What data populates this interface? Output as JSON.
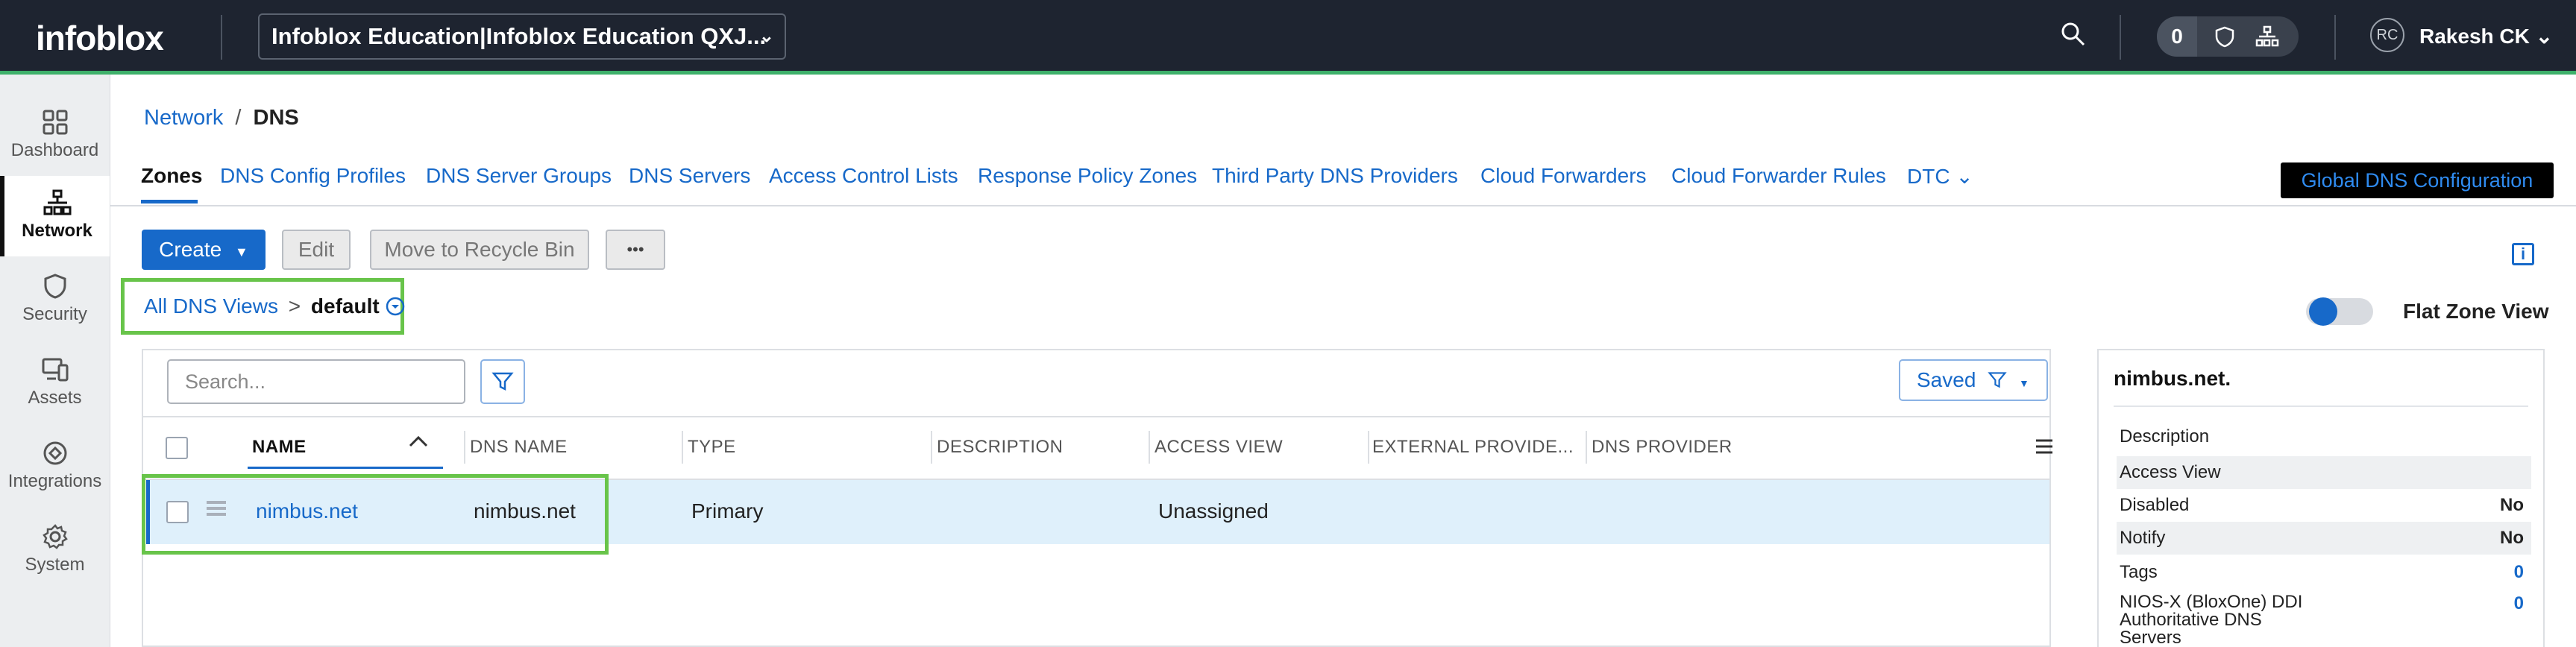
{
  "topbar": {
    "logo": "infoblox",
    "org_selector": "Infoblox Education|Infoblox Education QXJ...",
    "notification_count": "0",
    "user_initials": "RC",
    "user_name": "Rakesh CK"
  },
  "sidebar": {
    "items": [
      {
        "label": "Dashboard",
        "icon": "grid-icon"
      },
      {
        "label": "Network",
        "icon": "network-icon"
      },
      {
        "label": "Security",
        "icon": "shield-icon"
      },
      {
        "label": "Assets",
        "icon": "devices-icon"
      },
      {
        "label": "Integrations",
        "icon": "integrations-icon"
      },
      {
        "label": "System",
        "icon": "gear-icon"
      }
    ]
  },
  "breadcrumb": {
    "parent": "Network",
    "separator": "/",
    "current": "DNS"
  },
  "tabs": [
    "Zones",
    "DNS Config Profiles",
    "DNS Server Groups",
    "DNS Servers",
    "Access Control Lists",
    "Response Policy Zones",
    "Third Party DNS Providers",
    "Cloud Forwarders",
    "Cloud Forwarder Rules",
    "DTC"
  ],
  "global_button": "Global DNS Configuration",
  "toolbar": {
    "create": "Create",
    "edit": "Edit",
    "recycle": "Move to Recycle Bin",
    "more": "•••"
  },
  "views": {
    "all": "All DNS Views",
    "sep": ">",
    "current": "default"
  },
  "flat_zone_view": "Flat Zone View",
  "search": {
    "placeholder": "Search..."
  },
  "saved_button": "Saved",
  "table": {
    "columns": [
      "NAME",
      "DNS NAME",
      "TYPE",
      "DESCRIPTION",
      "ACCESS VIEW",
      "EXTERNAL PROVIDE...",
      "DNS PROVIDER"
    ],
    "rows": [
      {
        "name": "nimbus.net",
        "dns_name": "nimbus.net",
        "type": "Primary",
        "description": "",
        "access_view": "Unassigned",
        "external": "",
        "provider": ""
      }
    ]
  },
  "detail": {
    "title": "nimbus.net.",
    "rows": [
      {
        "key": "Description",
        "value": ""
      },
      {
        "key": "Access View",
        "value": ""
      },
      {
        "key": "Disabled",
        "value": "No"
      },
      {
        "key": "Notify",
        "value": "No"
      },
      {
        "key": "Tags",
        "value": "0"
      },
      {
        "key": "NIOS-X (BloxOne) DDI Authoritative DNS Servers",
        "value": "0"
      }
    ]
  },
  "colors": {
    "accent": "#1769c9",
    "highlight": "#68c44a",
    "topbar": "#1e2430"
  }
}
